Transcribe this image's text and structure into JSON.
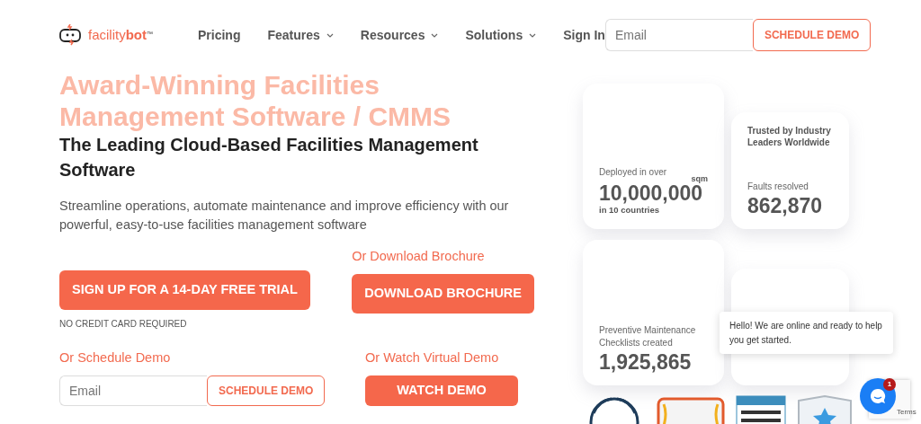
{
  "header": {
    "logo": "facility**bot**$^{™}$",
    "nav": [
      {
        "label": "Pricing",
        "has_menu": false
      },
      {
        "label": "Features",
        "has_menu": true
      },
      {
        "label": "Resources",
        "has_menu": true
      },
      {
        "label": "Solutions",
        "has_menu": true
      },
      {
        "label": "Sign In",
        "has_menu": false
      }
    ],
    "email": {
      "placeholder": "Email"
    },
    "demo_button": "SCHEDULE DEMO"
  },
  "hero": {
    "title": "Award-Winning Facilities Management Software / CMMS",
    "subtitle": "The Leading Cloud-Based Facilities Management Software",
    "description": "Streamline operations, automate maintenance and improve efficiency with our powerful, easy-to-use facilities management software",
    "trial_button": "SIGN UP FOR A 14-DAY FREE TRIAL",
    "trial_note": "NO CREDIT CARD REQUIRED",
    "brochure_label": "Or Download Brochure",
    "brochure_button": "DOWNLOAD BROCHURE",
    "schedule_label": "Or Schedule Demo",
    "schedule_email": {
      "placeholder": "Email"
    },
    "schedule_button": "SCHEDULE DEMO",
    "watch_label": "Or Watch Virtual Demo",
    "watch_button": "WATCH DEMO"
  },
  "stats": [
    {
      "kind": "tall",
      "label": "Deployed in over",
      "unit": "sqm",
      "value": "10,000,000",
      "note": "in 10 countries"
    },
    {
      "kind": "short",
      "heading": "Trusted by Industry Leaders Worldwide",
      "label": "Faults resolved",
      "value": "862,870"
    },
    {
      "kind": "tall",
      "label": "Preventive Maintenance Checklists created",
      "value": "1,925,865"
    },
    {
      "kind": "short"
    }
  ],
  "badges": [
    {
      "kind": "laurel"
    },
    {
      "kind": "ribbon"
    },
    {
      "kind": "certificate"
    },
    {
      "kind": "shield"
    }
  ],
  "chat": {
    "message": "Hello! We are online and ready to help you get started.",
    "unread": "1"
  },
  "recaptcha": {
    "text": "Terms"
  }
}
